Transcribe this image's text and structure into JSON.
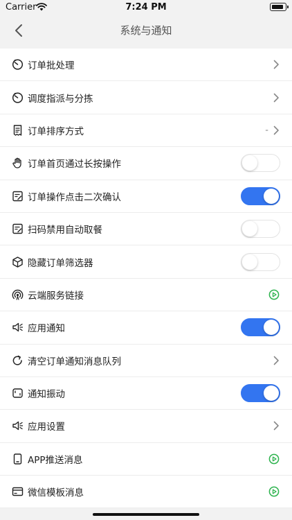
{
  "status_bar": {
    "carrier": "Carrier",
    "time": "7:24 PM"
  },
  "nav": {
    "title": "系统与通知"
  },
  "accent_color": "#3375f0",
  "play_color": "#2bb24c",
  "rows": [
    {
      "label": "订单批处理",
      "icon": "clock-icon",
      "control": "chevron"
    },
    {
      "label": "调度指派与分拣",
      "icon": "clock-icon",
      "control": "chevron"
    },
    {
      "label": "订单排序方式",
      "icon": "receipt-icon",
      "control": "chevron",
      "value": "-"
    },
    {
      "label": "订单首页通过长按操作",
      "icon": "hand-icon",
      "control": "toggle",
      "on": false
    },
    {
      "label": "订单操作点击二次确认",
      "icon": "edit-doc-icon",
      "control": "toggle",
      "on": true
    },
    {
      "label": "扫码禁用自动取餐",
      "icon": "edit-doc-icon",
      "control": "toggle",
      "on": false
    },
    {
      "label": "隐藏订单筛选器",
      "icon": "box-icon",
      "control": "toggle",
      "on": false
    },
    {
      "label": "云端服务链接",
      "icon": "signal-icon",
      "control": "play"
    },
    {
      "label": "应用通知",
      "icon": "speaker-icon",
      "control": "toggle",
      "on": true
    },
    {
      "label": "清空订单通知消息队列",
      "icon": "refresh-icon",
      "control": "chevron"
    },
    {
      "label": "通知振动",
      "icon": "vibrate-icon",
      "control": "toggle",
      "on": true
    },
    {
      "label": "应用设置",
      "icon": "speaker-icon",
      "control": "chevron"
    },
    {
      "label": "APP推送消息",
      "icon": "phone-icon",
      "control": "play"
    },
    {
      "label": "微信模板消息",
      "icon": "card-icon",
      "control": "play"
    }
  ]
}
